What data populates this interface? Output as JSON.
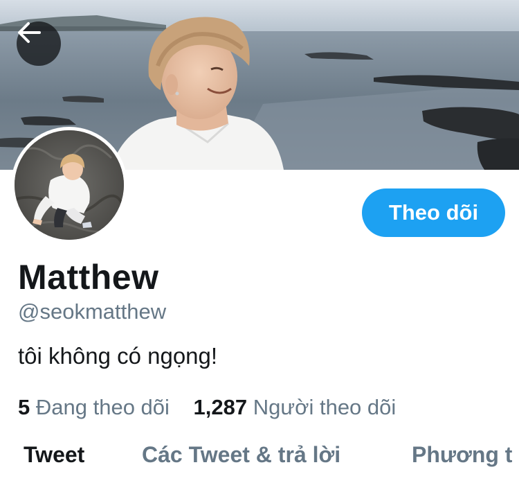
{
  "header": {
    "back_icon": "arrow-left-icon",
    "banner_description_icon": "banner-image"
  },
  "profile": {
    "display_name": "Matthew",
    "handle": "@seokmatthew",
    "bio": "tôi không có ngọng!",
    "follow_label": "Theo dõi",
    "following_count": "5",
    "following_label": "Đang theo dõi",
    "followers_count": "1,287",
    "followers_label": "Người theo dõi"
  },
  "tabs": [
    {
      "label": "Tweet",
      "active": true
    },
    {
      "label": "Các Tweet & trả lời",
      "active": false
    },
    {
      "label": "Phương t",
      "active": false
    }
  ],
  "colors": {
    "accent": "#1da1f2",
    "text_primary": "#14171a",
    "text_secondary": "#657786"
  }
}
